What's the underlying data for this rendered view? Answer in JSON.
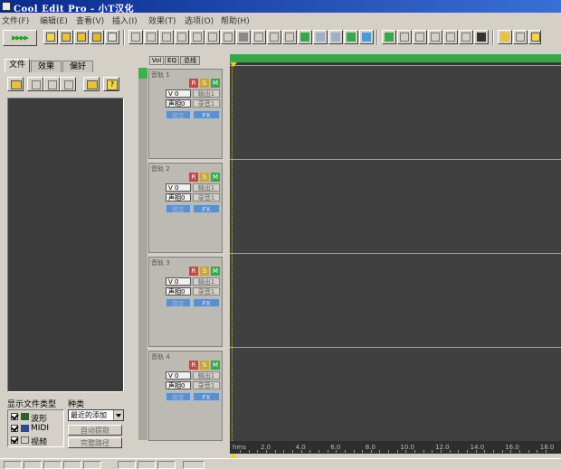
{
  "window": {
    "title": "Cool Edit Pro  - 小T汉化"
  },
  "menu": [
    "文件(F)",
    "编辑(E)",
    "查看(V)",
    "插入(I)",
    "效果(T)",
    "选项(O)",
    "帮助(H)"
  ],
  "organizer": {
    "tabs": [
      "文件",
      "效果",
      "偏好"
    ],
    "file_types_label": "显示文件类型",
    "sort_label": "种类",
    "file_types": [
      "波形",
      "MIDI",
      "视频"
    ],
    "sort_value": "最近的添加",
    "buttons": [
      "自动提取",
      "完整路径"
    ]
  },
  "tracks": {
    "view_tabs": [
      "Vol",
      "EQ",
      "总线"
    ],
    "items": [
      {
        "name": "音轨 1",
        "vol": "V 0",
        "pan": "声相0",
        "out": "输出1",
        "in": "录音1",
        "lock": "锁定",
        "fx": "FX"
      },
      {
        "name": "音轨 2",
        "vol": "V 0",
        "pan": "声相0",
        "out": "输出1",
        "in": "录音1",
        "lock": "锁定",
        "fx": "FX"
      },
      {
        "name": "音轨 3",
        "vol": "V 0",
        "pan": "声相0",
        "out": "输出1",
        "in": "录音1",
        "lock": "锁定",
        "fx": "FX"
      },
      {
        "name": "音轨 4",
        "vol": "V 0",
        "pan": "声相0",
        "out": "输出1",
        "in": "录音1",
        "lock": "锁定",
        "fx": "FX"
      }
    ],
    "rsm": [
      "R",
      "S",
      "M"
    ]
  },
  "timeline": {
    "unit": "hms",
    "ticks": [
      "2.0",
      "4.0",
      "6.0",
      "8.0",
      "10.0",
      "12.0",
      "14.0",
      "16.0",
      "18.0"
    ]
  },
  "colors": {
    "accent_green": "#3aa64c",
    "wave_bg": "#404040",
    "title_blue": "#0b2a8c"
  }
}
